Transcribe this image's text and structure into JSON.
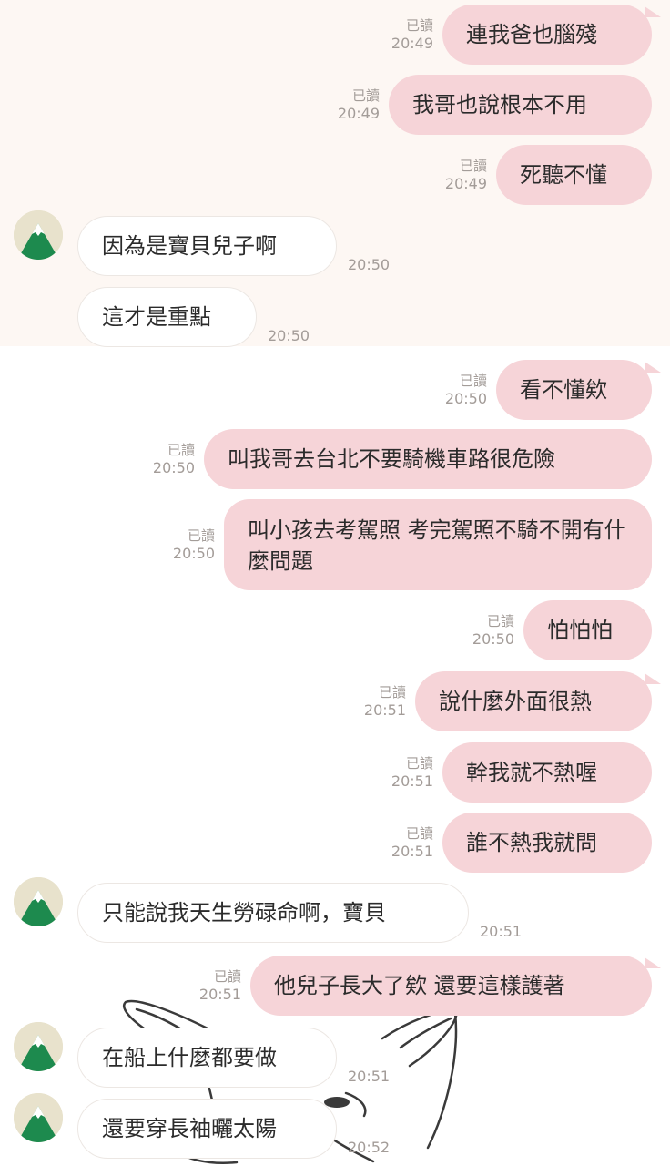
{
  "read_label": "已讀",
  "messages": [
    {
      "dir": "out",
      "text": "連我爸也腦殘",
      "time": "20:49"
    },
    {
      "dir": "out",
      "text": "我哥也說根本不用",
      "time": "20:49"
    },
    {
      "dir": "out",
      "text": "死聽不懂",
      "time": "20:49"
    },
    {
      "dir": "in",
      "text": "因為是寶貝兒子啊",
      "time": "20:50"
    },
    {
      "dir": "in",
      "text": "這才是重點",
      "time": "20:50"
    },
    {
      "dir": "out",
      "text": "看不懂欸",
      "time": "20:50"
    },
    {
      "dir": "out",
      "text": "叫我哥去台北不要騎機車路很危險",
      "time": "20:50"
    },
    {
      "dir": "out",
      "text": "叫小孩去考駕照 考完駕照不騎不開有什麼問題",
      "time": "20:50"
    },
    {
      "dir": "out",
      "text": "怕怕怕",
      "time": "20:50"
    },
    {
      "dir": "out",
      "text": "說什麼外面很熱",
      "time": "20:51"
    },
    {
      "dir": "out",
      "text": "幹我就不熱喔",
      "time": "20:51"
    },
    {
      "dir": "out",
      "text": "誰不熱我就問",
      "time": "20:51"
    },
    {
      "dir": "in",
      "text": "只能說我天生勞碌命啊，寶貝",
      "time": "20:51"
    },
    {
      "dir": "out",
      "text": "他兒子長大了欸 還要這樣護著",
      "time": "20:51"
    },
    {
      "dir": "in",
      "text": "在船上什麼都要做",
      "time": "20:51"
    },
    {
      "dir": "in",
      "text": "還要穿長袖曬太陽",
      "time": "20:52"
    }
  ],
  "colors": {
    "outgoing_bubble": "#f6d4d8",
    "incoming_bubble": "#ffffff",
    "top_background": "#fdf7f3",
    "meta_text": "#a39c98",
    "avatar_mountain": "#1d8a4e"
  },
  "icons": {
    "avatar": "mountain-avatar-icon"
  }
}
